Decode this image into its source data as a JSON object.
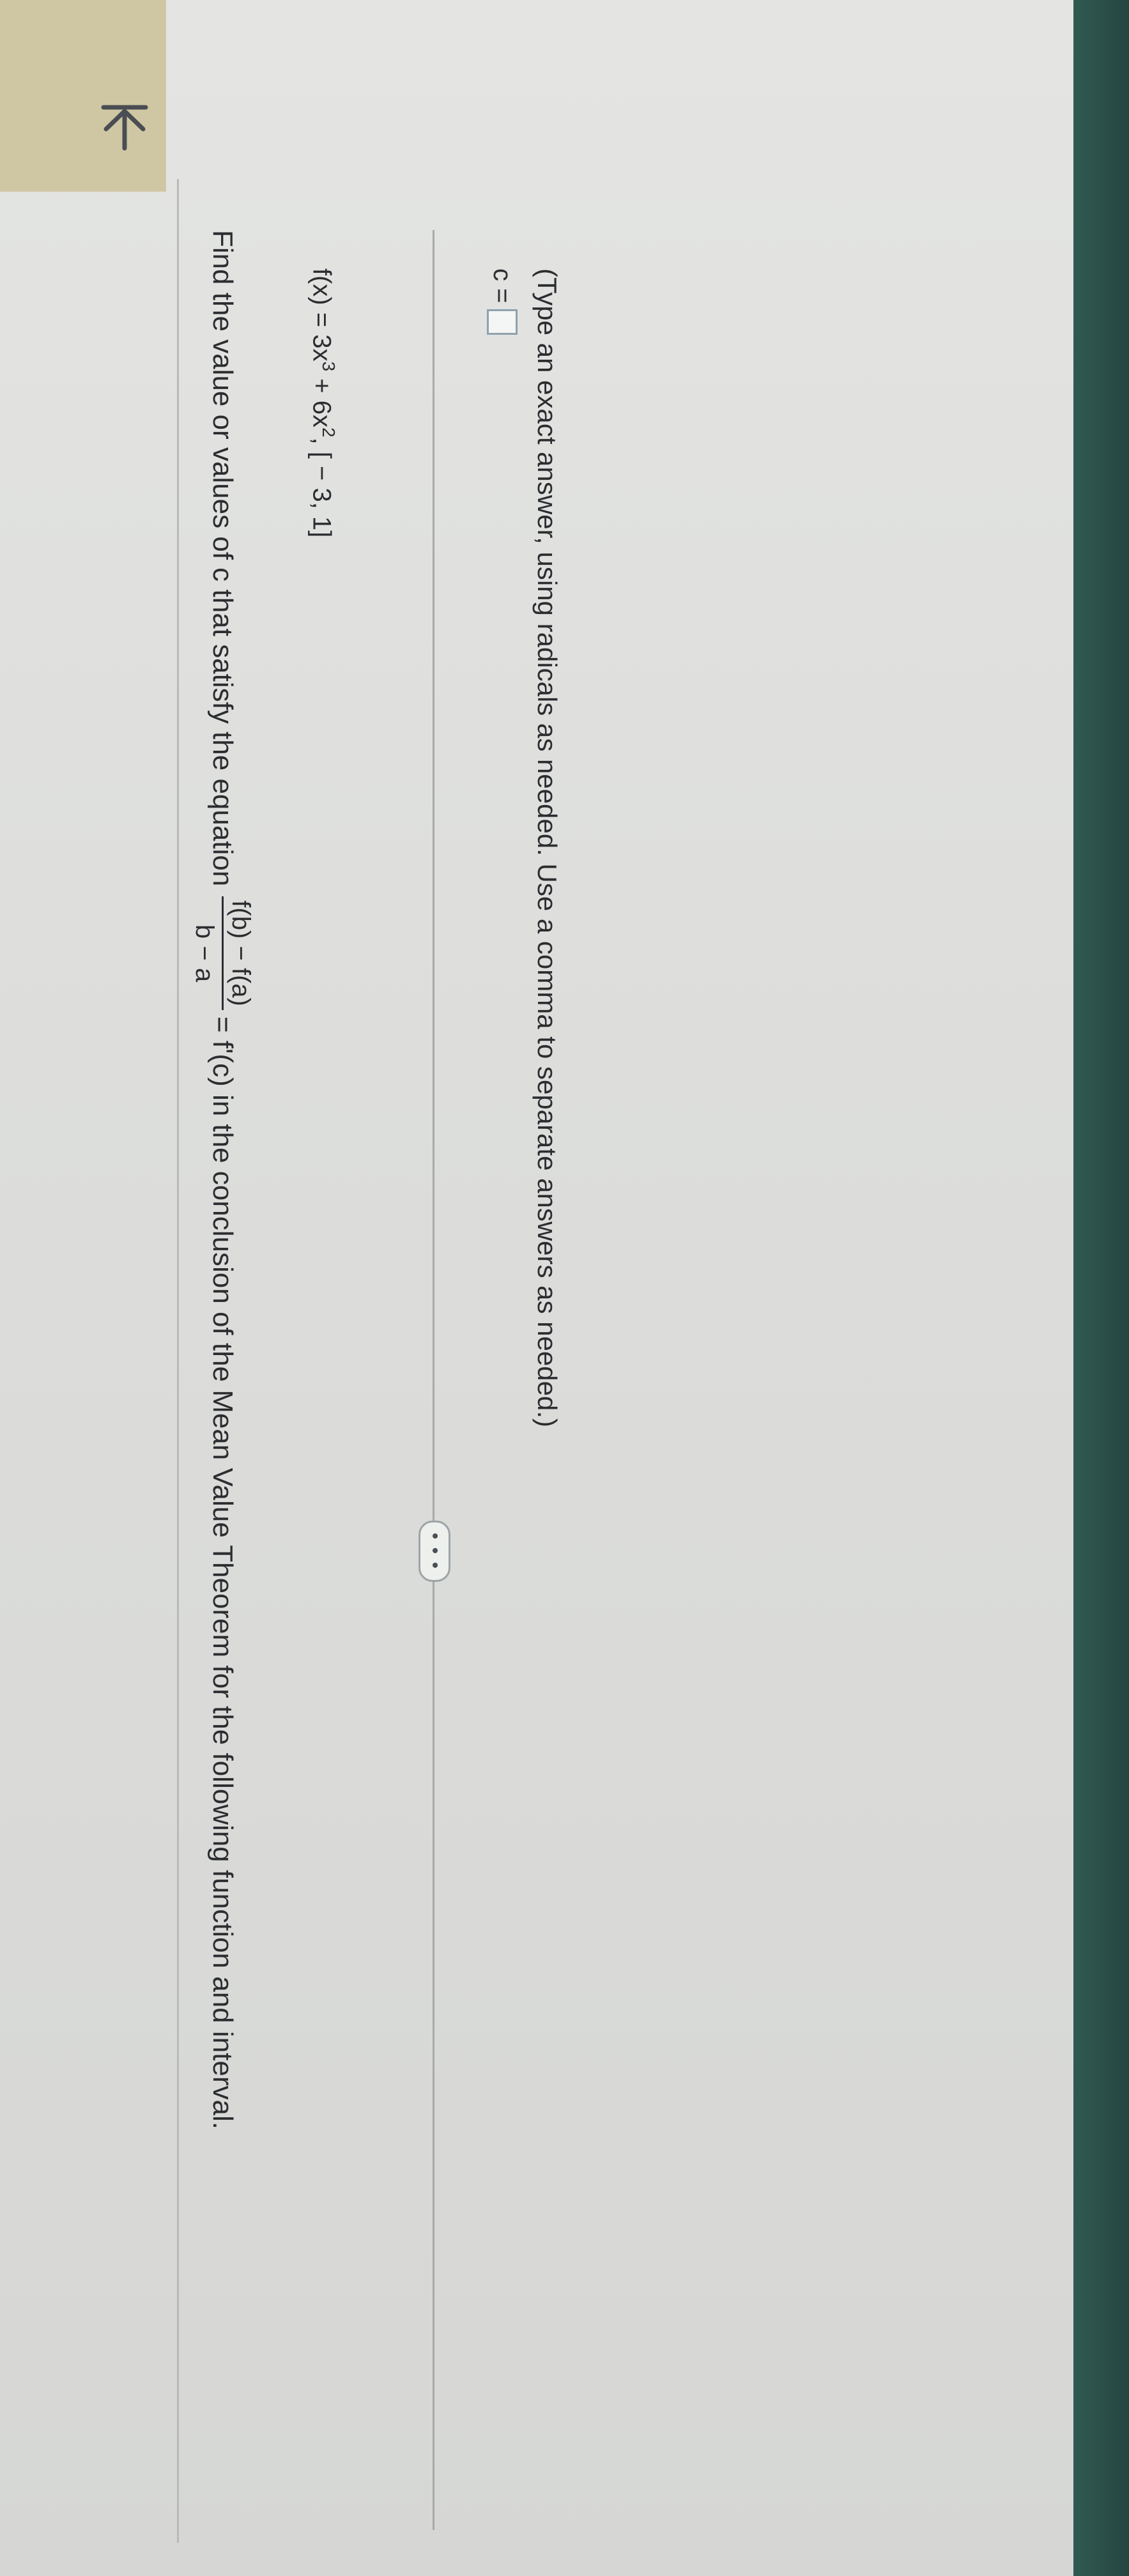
{
  "question": {
    "prefix": "Find the value or values of c that satisfy the equation",
    "fraction_numerator": "f(b) − f(a)",
    "fraction_denominator": "b − a",
    "suffix": "= f'(c) in the conclusion of the Mean Value Theorem for the following function and interval."
  },
  "function": {
    "lhs": "f(x) = 3x",
    "exp1": "3",
    "mid": " + 6x",
    "exp2": "2",
    "interval": ",  [ − 3, 1]"
  },
  "more_button": {
    "label": "• • •"
  },
  "answer": {
    "label": "c ="
  },
  "hint": "(Type an exact answer, using radicals as needed. Use a comma to separate answers as needed.)",
  "icons": {
    "back": "first-page-icon"
  }
}
